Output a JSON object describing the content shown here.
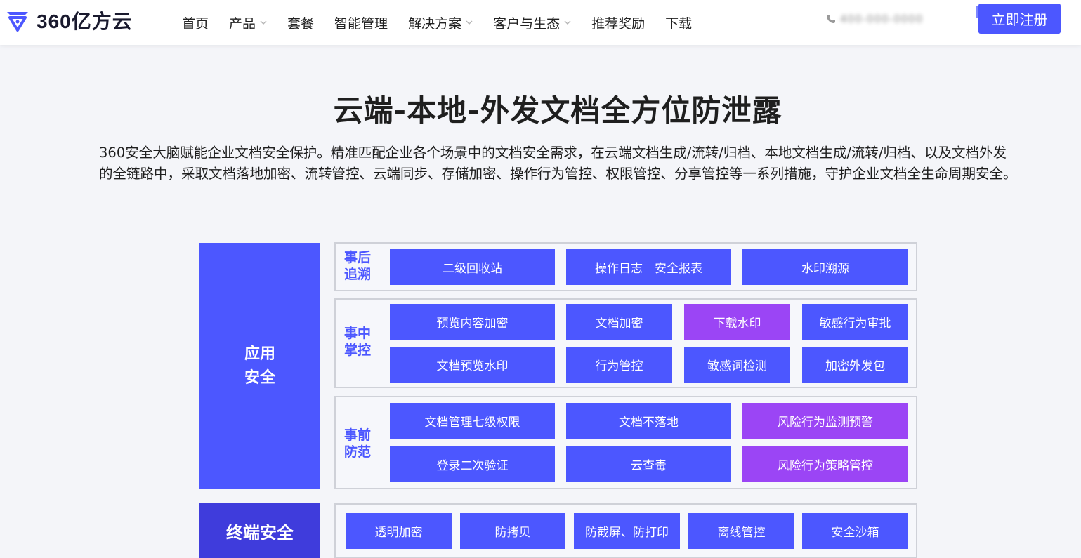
{
  "header": {
    "brand": "360亿方云",
    "nav": [
      {
        "label": "首页",
        "has_dropdown": false
      },
      {
        "label": "产品",
        "has_dropdown": true
      },
      {
        "label": "套餐",
        "has_dropdown": false
      },
      {
        "label": "智能管理",
        "has_dropdown": false
      },
      {
        "label": "解决方案",
        "has_dropdown": true
      },
      {
        "label": "客户与生态",
        "has_dropdown": true
      },
      {
        "label": "推荐奖励",
        "has_dropdown": false
      },
      {
        "label": "下载",
        "has_dropdown": false
      }
    ],
    "phone_obscured": "400-000-0000",
    "register_label": "立即注册"
  },
  "section": {
    "title": "云端-本地-外发文档全方位防泄露",
    "description": "360安全大脑赋能企业文档安全保护。精准匹配企业各个场景中的文档安全需求，在云端文档生成/流转/归档、本地文档生成/流转/归档、以及文档外发的全链路中，采取文档落地加密、流转管控、云端同步、存储加密、操作行为管控、权限管控、分享管控等一系列措施，守护企业文档全生命周期安全。"
  },
  "diagram": {
    "categories": {
      "app_security": {
        "line1": "应用",
        "line2": "安全"
      },
      "terminal_security": "终端安全"
    },
    "groups": {
      "post": {
        "label_line1": "事后",
        "label_line2": "追溯",
        "tiles": [
          "二级回收站",
          "操作日志　安全报表",
          "水印溯源"
        ]
      },
      "during": {
        "label_line1": "事中",
        "label_line2": "掌控",
        "tiles": [
          "预览内容加密",
          "文档加密",
          "下载水印",
          "敏感行为审批",
          "文档预览水印",
          "行为管控",
          "敏感词检测",
          "加密外发包"
        ]
      },
      "pre": {
        "label_line1": "事前",
        "label_line2": "防范",
        "tiles": [
          "文档管理七级权限",
          "文档不落地",
          "风险行为监测预警",
          "登录二次验证",
          "云查毒",
          "风险行为策略管控"
        ]
      },
      "terminal": {
        "tiles": [
          "透明加密",
          "防拷贝",
          "防截屏、防打印",
          "离线管控",
          "安全沙箱"
        ]
      }
    },
    "colors": {
      "primary": "#4c57ff",
      "highlight": "#9b45f5",
      "terminal_category": "#3f3cdc"
    }
  }
}
